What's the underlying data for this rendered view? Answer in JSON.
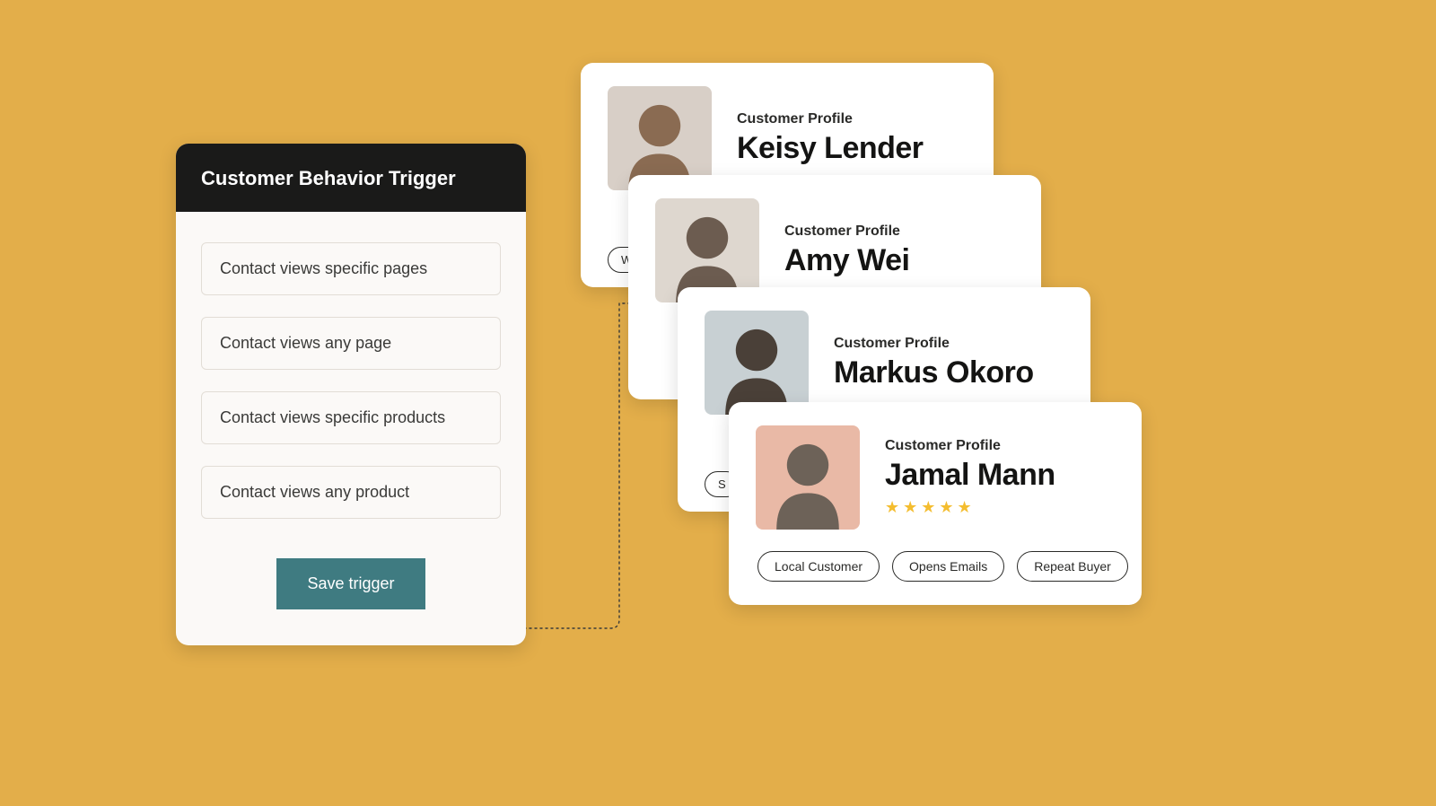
{
  "trigger": {
    "title": "Customer Behavior Trigger",
    "options": [
      "Contact views specific pages",
      "Contact views any page",
      "Contact views specific products",
      "Contact views any product"
    ],
    "save_label": "Save trigger"
  },
  "profile_label": "Customer Profile",
  "profiles": [
    {
      "name": "Keisy Lender",
      "avatar_bg": "#d8cfc7",
      "avatar_fg": "#8a6b52",
      "peek": "W"
    },
    {
      "name": "Amy Wei",
      "avatar_bg": "#ded7cf",
      "avatar_fg": "#6c5c50",
      "peek": ""
    },
    {
      "name": "Markus Okoro",
      "avatar_bg": "#c8d0d3",
      "avatar_fg": "#4a4038",
      "peek": "S"
    },
    {
      "name": "Jamal Mann",
      "avatar_bg": "#e9b9a6",
      "avatar_fg": "#6d6258"
    }
  ],
  "front_card": {
    "stars": 5,
    "tags": [
      "Local Customer",
      "Opens Emails",
      "Repeat Buyer"
    ]
  },
  "colors": {
    "accent_teal": "#3f7b81",
    "star": "#f4bd2f"
  }
}
